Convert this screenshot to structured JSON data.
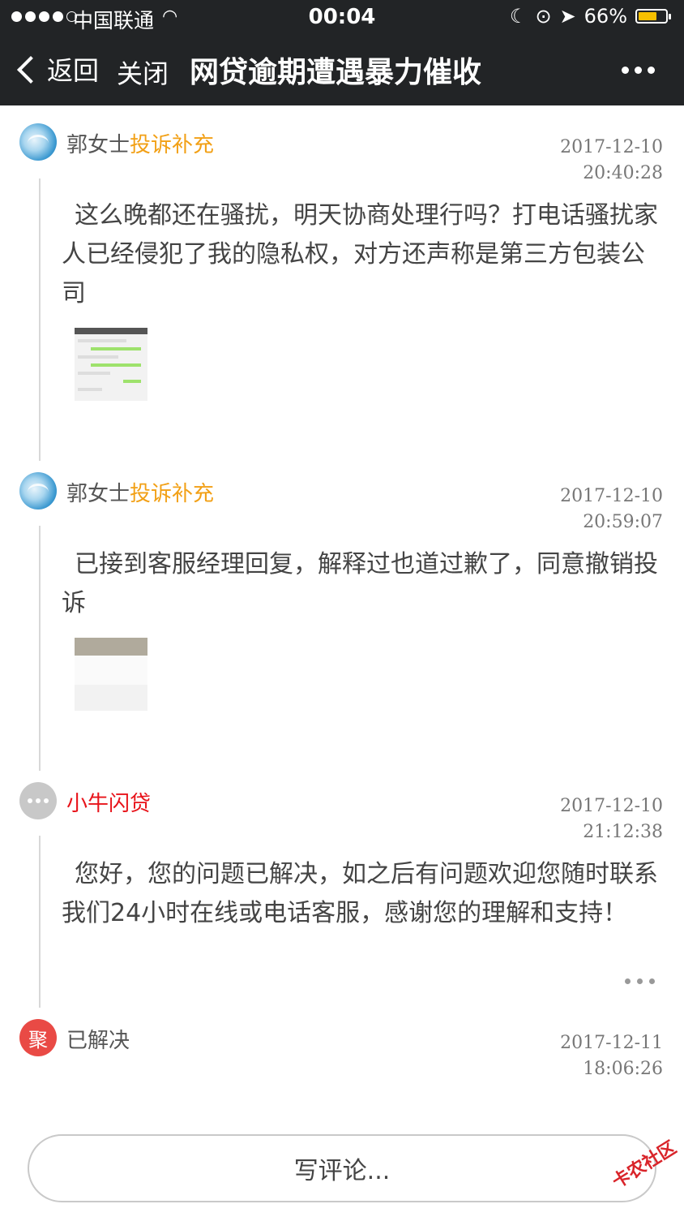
{
  "status_bar": {
    "carrier": "中国联通",
    "time": "00:04",
    "battery": "66%"
  },
  "nav": {
    "back_label": "返回",
    "close_label": "关闭",
    "title": "网贷逾期遭遇暴力催收"
  },
  "timeline": [
    {
      "name": "郭女士",
      "tag": "投诉补充",
      "date": "2017-12-10",
      "time": "20:40:28",
      "message": "这么晚都还在骚扰，明天协商处理行吗？打电话骚扰家人已经侵犯了我的隐私权，对方还声称是第三方包装公司"
    },
    {
      "name": "郭女士",
      "tag": "投诉补充",
      "date": "2017-12-10",
      "time": "20:59:07",
      "message": "已接到客服经理回复，解释过也道过歉了，同意撤销投诉"
    },
    {
      "name": "小牛闪贷",
      "date": "2017-12-10",
      "time": "21:12:38",
      "message": "您好，您的问题已解决，如之后有问题欢迎您随时联系我们24小时在线或电话客服，感谢您的理解和支持！"
    },
    {
      "avatar_text": "聚",
      "name": "已解决",
      "date": "2017-12-11",
      "time": "18:06:26"
    }
  ],
  "comment": {
    "placeholder": "写评论..."
  },
  "watermark": "卡农社区",
  "colors": {
    "nav_bg": "#222426",
    "tag_orange": "#f2a016",
    "company_red": "#e8131a",
    "resolved_red": "#e94a45"
  }
}
